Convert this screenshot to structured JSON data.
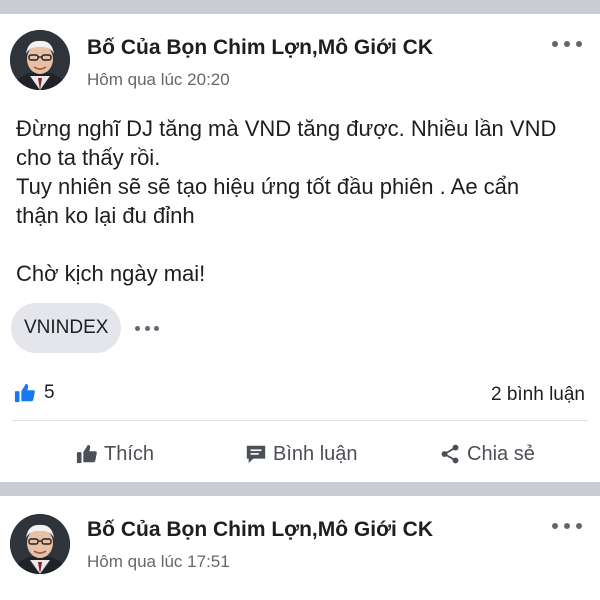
{
  "post1": {
    "author": "Bố Của Bọn Chim Lợn,Mô Giới CK",
    "time": "Hôm qua lúc 20:20",
    "text_lines": [
      "Đừng nghĩ DJ tăng mà VND tăng được. Nhiều lần VND",
      "cho ta thấy rồi.",
      "Tuy nhiên sẽ sẽ tạo hiệu ứng tốt đầu phiên . Ae cẩn",
      "thận ko lại đu đỉnh",
      "",
      "Chờ kịch ngày mai!"
    ],
    "tag": "VNINDEX",
    "likes": "5",
    "comments": "2 bình luận",
    "actions": {
      "like": "Thích",
      "comment": "Bình luận",
      "share": "Chia sẻ"
    }
  },
  "post2": {
    "author": "Bố Của Bọn Chim Lợn,Mô Giới CK",
    "time": "Hôm qua lúc 17:51"
  },
  "colors": {
    "accent": "#1877f2",
    "divider": "#c9ccd1",
    "secondary_text": "#65676b"
  },
  "icons": [
    "more-horizontal-icon",
    "thumbs-up-icon",
    "comment-icon",
    "share-icon"
  ]
}
